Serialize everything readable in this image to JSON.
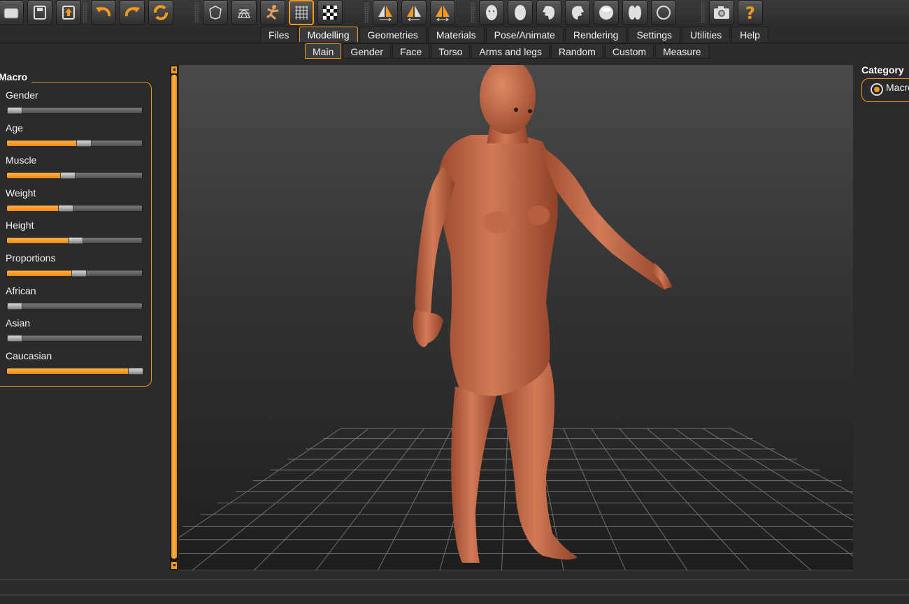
{
  "toolbar": {
    "buttons": [
      {
        "icon": "open-folder-icon"
      },
      {
        "icon": "save-icon"
      },
      {
        "icon": "export-icon"
      },
      {
        "icon": "undo-icon"
      },
      {
        "icon": "redo-icon"
      },
      {
        "icon": "reset-icon"
      },
      {
        "icon": "smooth-icon"
      },
      {
        "icon": "wireframe-icon"
      },
      {
        "icon": "pose-icon"
      },
      {
        "icon": "grid-icon",
        "active": true
      },
      {
        "icon": "checkerboard-icon"
      },
      {
        "icon": "symmetry-right-icon"
      },
      {
        "icon": "symmetry-left-icon"
      },
      {
        "icon": "symmetry-both-icon"
      },
      {
        "icon": "front-view-icon"
      },
      {
        "icon": "back-view-icon"
      },
      {
        "icon": "left-view-icon"
      },
      {
        "icon": "right-view-icon"
      },
      {
        "icon": "top-view-icon"
      },
      {
        "icon": "bottom-view-icon"
      },
      {
        "icon": "reset-camera-icon"
      },
      {
        "icon": "screenshot-icon"
      },
      {
        "icon": "help-icon"
      }
    ]
  },
  "tabs": [
    "Files",
    "Modelling",
    "Geometries",
    "Materials",
    "Pose/Animate",
    "Rendering",
    "Settings",
    "Utilities",
    "Help"
  ],
  "active_tab": "Modelling",
  "subtabs": [
    "Main",
    "Gender",
    "Face",
    "Torso",
    "Arms and legs",
    "Random",
    "Custom",
    "Measure"
  ],
  "active_subtab": "Main",
  "left_panel": {
    "group_title": "Macro",
    "sliders": [
      {
        "label": "Gender",
        "value": 0.0
      },
      {
        "label": "Age",
        "value": 0.57
      },
      {
        "label": "Muscle",
        "value": 0.44
      },
      {
        "label": "Weight",
        "value": 0.42
      },
      {
        "label": "Height",
        "value": 0.5
      },
      {
        "label": "Proportions",
        "value": 0.53
      },
      {
        "label": "African",
        "value": 0.0
      },
      {
        "label": "Asian",
        "value": 0.0
      },
      {
        "label": "Caucasian",
        "value": 1.0
      }
    ]
  },
  "right_panel": {
    "title": "Category",
    "option": "Macro"
  },
  "colors": {
    "accent": "#f39a1e",
    "skin": "#c86a4a",
    "background": "#2b2b2b"
  }
}
